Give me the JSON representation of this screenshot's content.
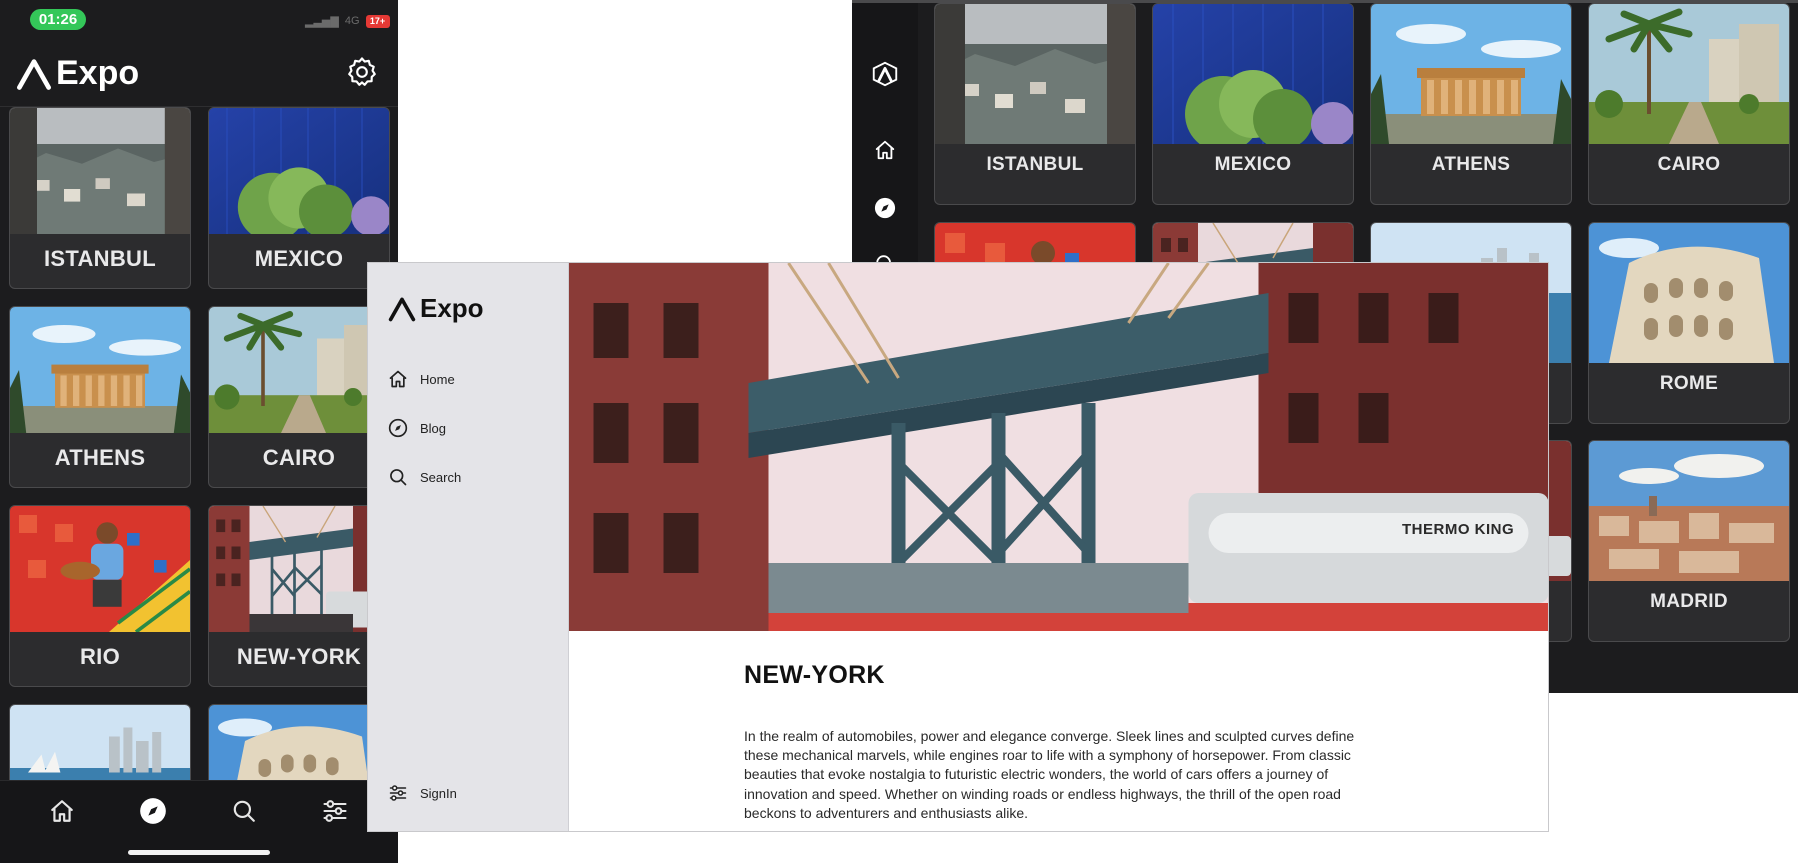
{
  "brand": {
    "name": "Expo"
  },
  "phone": {
    "status": {
      "time": "01:26",
      "network": "4G",
      "battery": "17+"
    },
    "cities": [
      {
        "name": "ISTANBUL",
        "image": "istanbul-hillside-photo"
      },
      {
        "name": "MEXICO",
        "image": "mexico-glass-tower-photo"
      },
      {
        "name": "ATHENS",
        "image": "athens-parthenon-photo"
      },
      {
        "name": "CAIRO",
        "image": "cairo-palm-street-photo"
      },
      {
        "name": "RIO",
        "image": "rio-selaron-steps-photo"
      },
      {
        "name": "NEW-YORK",
        "image": "new-york-bridge-photo"
      },
      {
        "name": "",
        "image": "sydney-harbour-photo"
      },
      {
        "name": "",
        "image": "rome-colosseum-photo"
      }
    ],
    "tabs": [
      {
        "icon": "home-icon"
      },
      {
        "icon": "compass-icon",
        "active": true
      },
      {
        "icon": "search-icon"
      },
      {
        "icon": "sliders-icon"
      }
    ]
  },
  "tablet": {
    "cities": [
      {
        "name": "ISTANBUL",
        "image": "istanbul-hillside-photo"
      },
      {
        "name": "MEXICO",
        "image": "mexico-glass-tower-photo"
      },
      {
        "name": "ATHENS",
        "image": "athens-parthenon-photo"
      },
      {
        "name": "CAIRO",
        "image": "cairo-palm-street-photo"
      },
      {
        "name": "",
        "image": "rio-selaron-steps-photo"
      },
      {
        "name": "",
        "image": "new-york-bridge-photo"
      },
      {
        "name": "",
        "image": "sydney-harbour-photo"
      },
      {
        "name": "ROME",
        "image": "rome-colosseum-photo"
      },
      {
        "name": "MADRID",
        "image": "madrid-cityscape-photo"
      }
    ]
  },
  "desktop": {
    "nav": [
      {
        "label": "Home",
        "icon": "home-icon"
      },
      {
        "label": "Blog",
        "icon": "compass-icon"
      },
      {
        "label": "Search",
        "icon": "search-icon"
      }
    ],
    "signin": {
      "label": "SignIn",
      "icon": "sliders-icon"
    },
    "article": {
      "title": "NEW-YORK",
      "body": "In the realm of automobiles, power and elegance converge. Sleek lines and sculpted curves define these mechanical marvels, while engines roar to life with a symphony of horsepower. From classic beauties that evoke nostalgia to futuristic electric wonders, the world of cars offers a journey of innovation and speed. Whether on winding roads or endless highways, the thrill of the open road beckons to adventurers and enthusiasts alike.",
      "hero_image": "brooklyn-manhattan-bridge-photo",
      "hero_sign": "THERMO KING"
    }
  },
  "colors": {
    "dark_bg": "#1c1c1e",
    "card_bg": "#2c2c2e",
    "accent_green": "#34c759",
    "battery_red": "#e53935",
    "sidebar_bg": "#e4e4e8"
  }
}
